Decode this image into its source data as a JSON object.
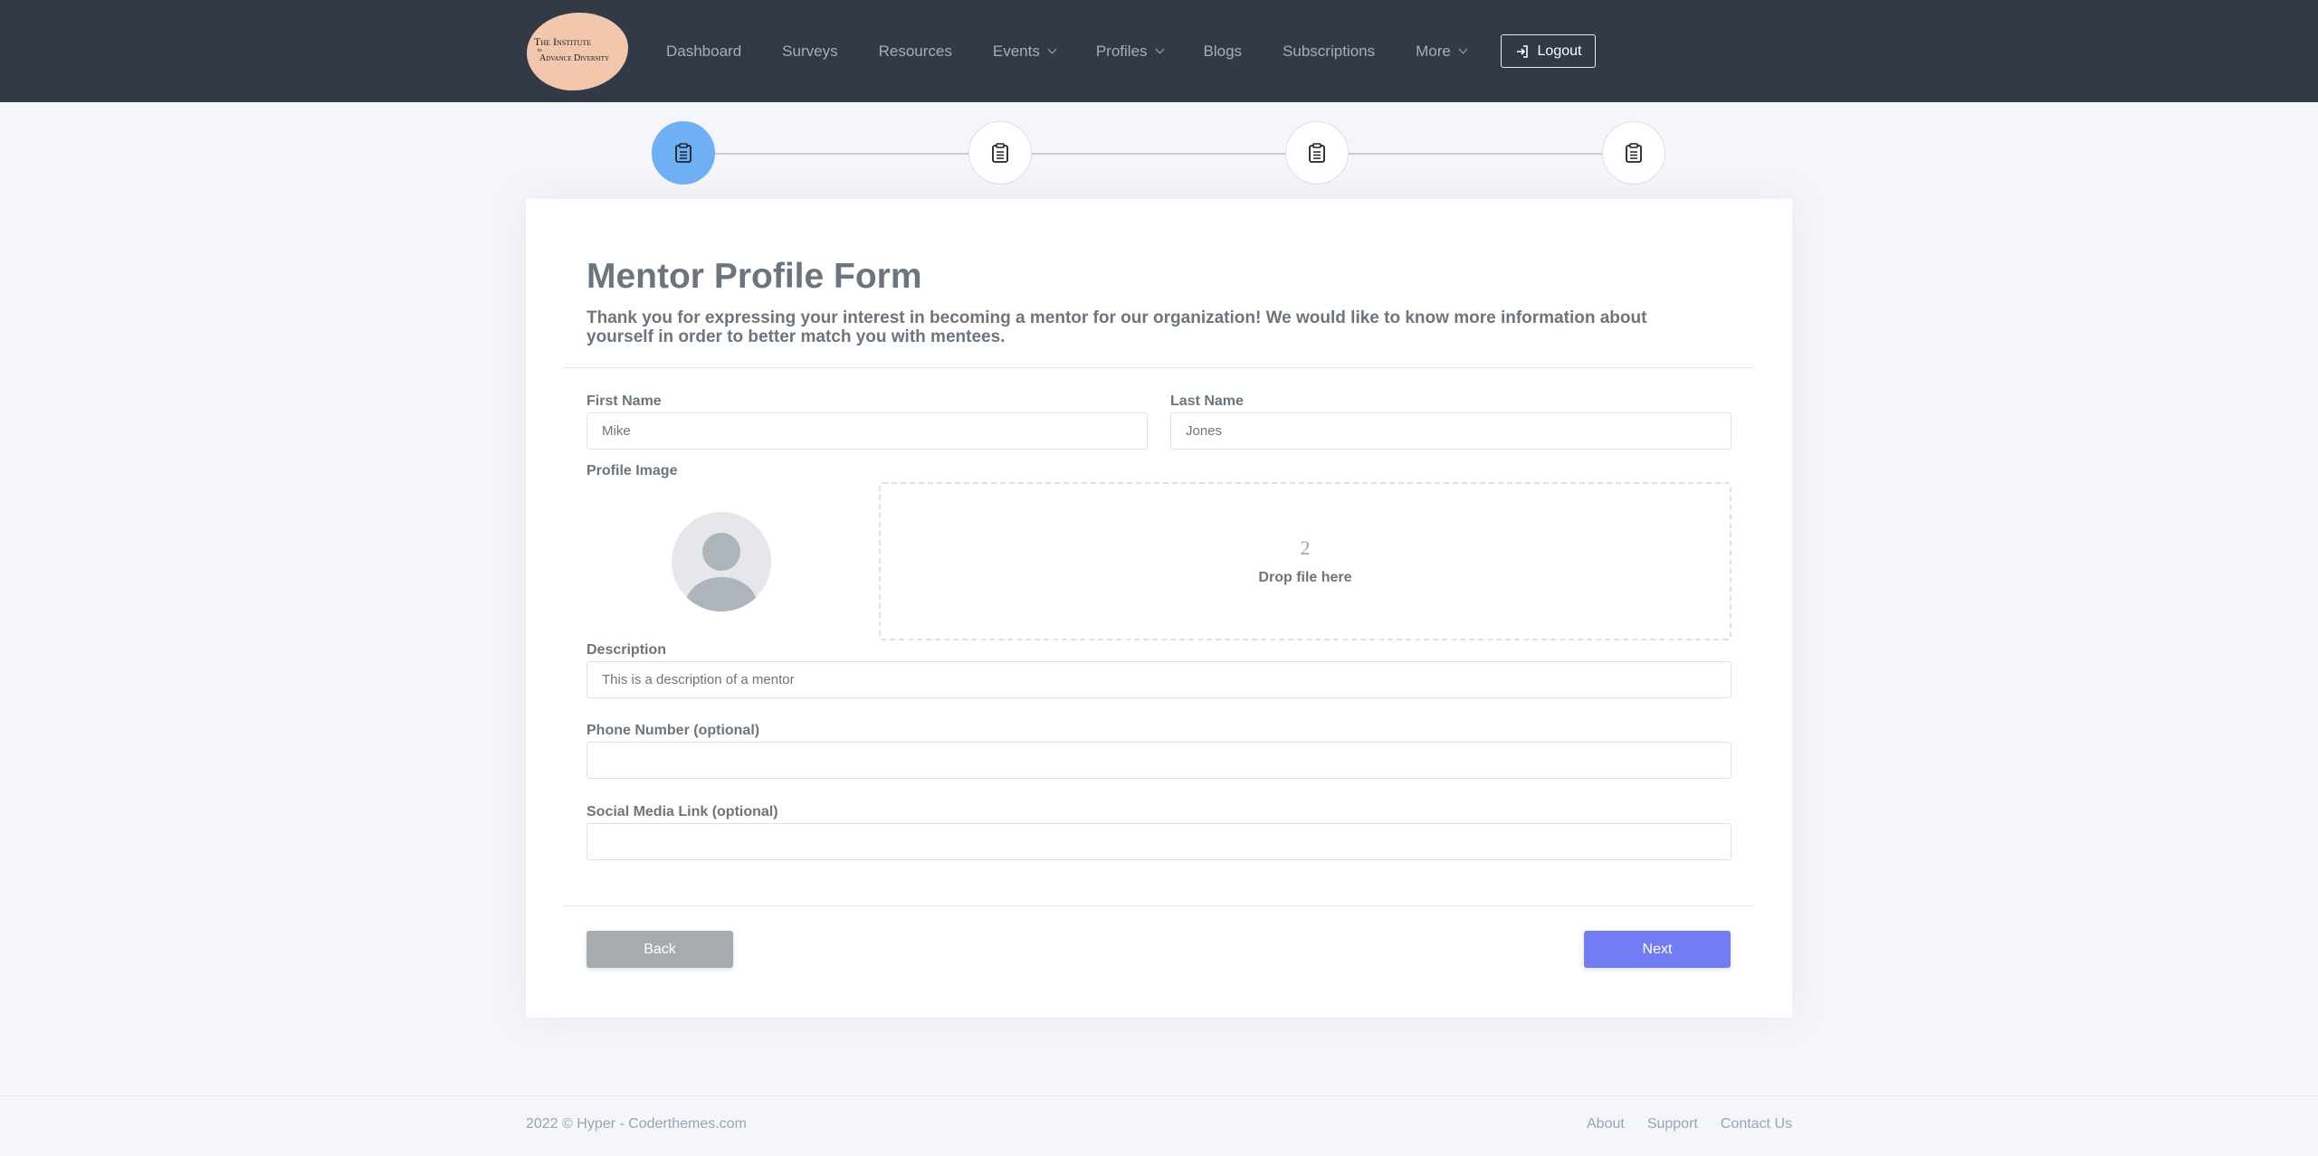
{
  "logo": {
    "line1": "The Institute",
    "line2": "to",
    "line3": "Advance Diversity"
  },
  "nav": {
    "items": [
      {
        "label": "Dashboard"
      },
      {
        "label": "Surveys"
      },
      {
        "label": "Resources"
      },
      {
        "label": "Events"
      },
      {
        "label": "Profiles"
      },
      {
        "label": "Blogs"
      },
      {
        "label": "Subscriptions"
      },
      {
        "label": "More"
      }
    ],
    "logout_label": "Logout"
  },
  "stepper": {
    "steps": 4,
    "active_step": 1,
    "icon": "clipboard-icon",
    "active_color": "#6fb0f5"
  },
  "form": {
    "title": "Mentor Profile Form",
    "subtitle": "Thank you for expressing your interest in becoming a mentor for our organization! We would like to know more information about yourself in order to better match you with mentees.",
    "first_name": {
      "label": "First Name",
      "value": "Mike"
    },
    "last_name": {
      "label": "Last Name",
      "value": "Jones"
    },
    "profile_image": {
      "label": "Profile Image",
      "dropzone_number": "2",
      "dropzone_text": "Drop file here"
    },
    "description": {
      "label": "Description",
      "value": "This is a description of a mentor"
    },
    "phone": {
      "label": "Phone Number (optional)",
      "value": ""
    },
    "social": {
      "label": "Social Media Link (optional)",
      "value": ""
    },
    "back_label": "Back",
    "next_label": "Next"
  },
  "footer": {
    "copyright": "2022 © Hyper - Coderthemes.com",
    "links": [
      {
        "label": "About"
      },
      {
        "label": "Support"
      },
      {
        "label": "Contact Us"
      }
    ]
  },
  "colors": {
    "topbar": "#313a46",
    "primary": "#727cf5",
    "secondary": "#a6abb0"
  }
}
